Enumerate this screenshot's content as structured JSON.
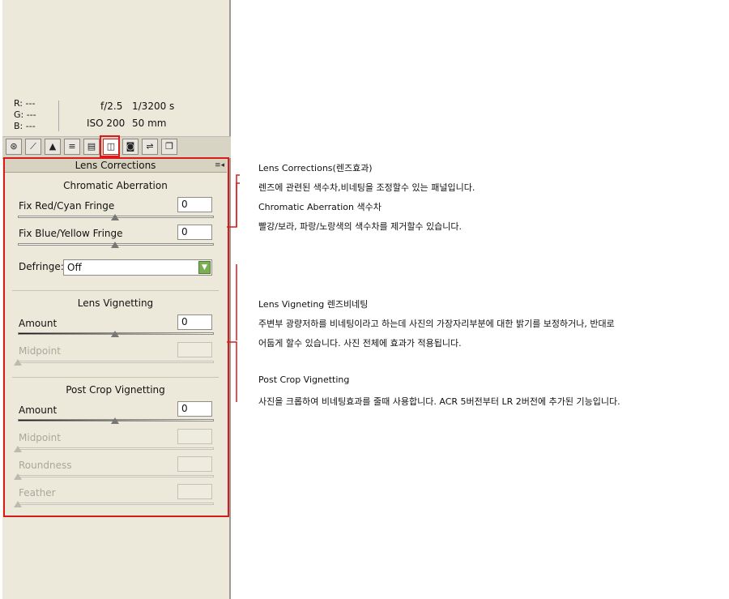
{
  "histogram": {
    "colors": [
      "#e02424",
      "#ffee22",
      "#22aa22",
      "#2255dd",
      "#cc22cc",
      "#22cccc",
      "#ffffff"
    ]
  },
  "info": {
    "r_label": "R:",
    "r_value": "---",
    "g_label": "G:",
    "g_value": "---",
    "b_label": "B:",
    "b_value": "---",
    "aperture": "f/2.5",
    "shutter": "1/3200 s",
    "iso": "ISO 200",
    "focal": "50 mm"
  },
  "tabs": [
    {
      "icon": "aperture-icon",
      "glyph": "⊛"
    },
    {
      "icon": "tone-curve-icon",
      "glyph": "⟋"
    },
    {
      "icon": "detail-icon",
      "glyph": "▲"
    },
    {
      "icon": "hsl-icon",
      "glyph": "≡"
    },
    {
      "icon": "split-toning-icon",
      "glyph": "▤"
    },
    {
      "icon": "lens-corrections-icon",
      "glyph": "◫"
    },
    {
      "icon": "camera-calibration-icon",
      "glyph": "◙"
    },
    {
      "icon": "presets-icon",
      "glyph": "⇌"
    },
    {
      "icon": "snapshots-icon",
      "glyph": "❐"
    }
  ],
  "panel": {
    "title": "Lens Corrections",
    "menu_glyph": "≡◂"
  },
  "chromatic": {
    "heading": "Chromatic Aberration",
    "red_cyan_label": "Fix Red/Cyan Fringe",
    "red_cyan_value": "0",
    "blue_yellow_label": "Fix Blue/Yellow Fringe",
    "blue_yellow_value": "0",
    "defringe_label": "Defringe:",
    "defringe_value": "Off"
  },
  "lens_vignetting": {
    "heading": "Lens Vignetting",
    "amount_label": "Amount",
    "amount_value": "0",
    "midpoint_label": "Midpoint",
    "midpoint_value": ""
  },
  "post_crop": {
    "heading": "Post Crop Vignetting",
    "amount_label": "Amount",
    "amount_value": "0",
    "midpoint_label": "Midpoint",
    "midpoint_value": "",
    "roundness_label": "Roundness",
    "roundness_value": "",
    "feather_label": "Feather",
    "feather_value": ""
  },
  "notes": {
    "lc_title": "Lens Corrections(렌즈효과)",
    "lc_desc": "렌즈에 관련된 색수차,비네팅을 조정할수 있는 패널입니다.",
    "ca_title": "Chromatic Aberration 색수차",
    "ca_desc": "빨강/보라, 파랑/노랑색의 색수차를 제거할수 있습니다.",
    "lv_title": "Lens Vigneting 렌즈비네팅",
    "lv_desc1": "주변부 광량저하를 비네팅이라고 하는데 사진의 가장자리부분에 대한 밝기를 보정하거나, 반대로",
    "lv_desc2": "어둡게 할수 있습니다. 사진 전체에 효과가 적용됩니다.",
    "pc_title": "Post Crop Vignetting",
    "pc_desc": "사진을 크롭하여 비네팅효과를 줄때 사용합니다. ACR 5버전부터 LR 2버전에 추가된 기능입니다."
  },
  "accent": "#d81c1c"
}
